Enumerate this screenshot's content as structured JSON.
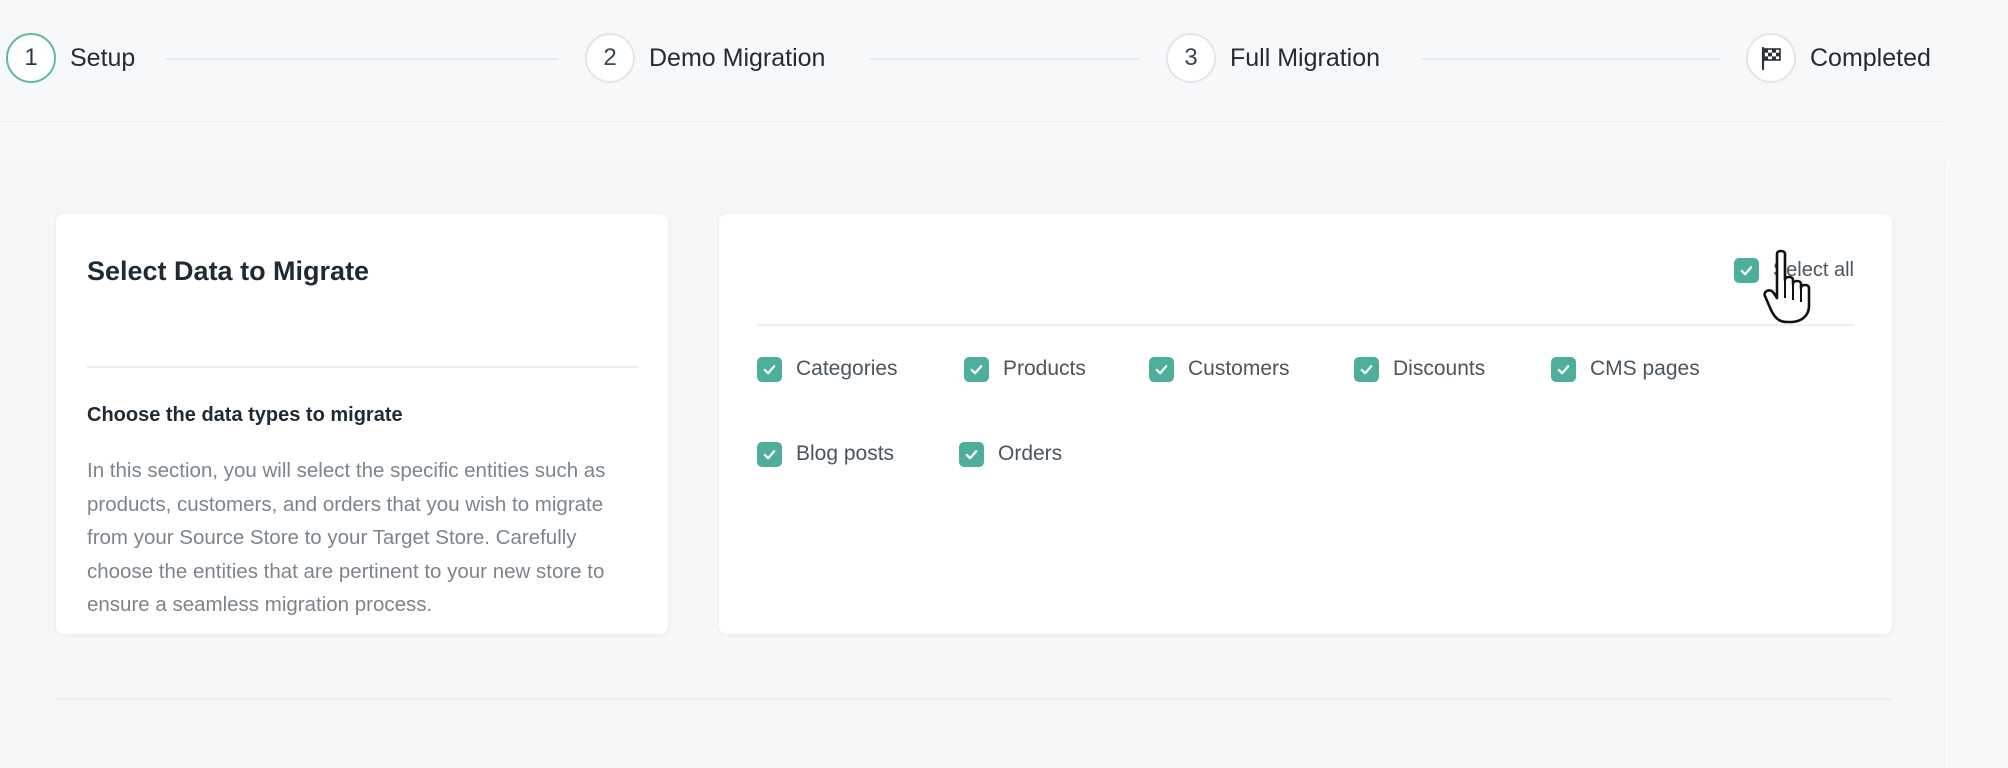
{
  "stepper": {
    "steps": [
      {
        "number": "1",
        "label": "Setup"
      },
      {
        "number": "2",
        "label": "Demo Migration"
      },
      {
        "number": "3",
        "label": "Full Migration"
      },
      {
        "number": "",
        "label": "Completed",
        "icon": "flag-icon"
      }
    ],
    "active_step": 1,
    "accent_color": "#5fb8a5"
  },
  "info_card": {
    "title": "Select Data to Migrate",
    "heading": "Choose the data types to migrate",
    "description": "In this section, you will select the specific entities such as products, customers, and orders that you wish to migrate from your Source Store to your Target Store. Carefully choose the entities that are pertinent to your new store to ensure a seamless migration process."
  },
  "select_card": {
    "select_all": {
      "label": "Select all",
      "checked": true
    },
    "entities": [
      {
        "label": "Categories",
        "checked": true
      },
      {
        "label": "Products",
        "checked": true
      },
      {
        "label": "Customers",
        "checked": true
      },
      {
        "label": "Discounts",
        "checked": true
      },
      {
        "label": "CMS pages",
        "checked": true
      },
      {
        "label": "Blog posts",
        "checked": true
      },
      {
        "label": "Orders",
        "checked": true
      }
    ],
    "checkbox_color": "#4eae9c"
  }
}
